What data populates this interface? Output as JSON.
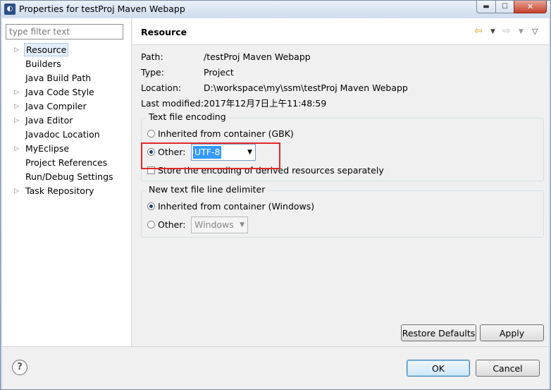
{
  "window": {
    "title": "Properties for testProj Maven Webapp",
    "minimize_glyph": "▬",
    "maximize_glyph": "☐",
    "close_glyph": "✕"
  },
  "filter": {
    "placeholder": "type filter text"
  },
  "tree": [
    {
      "label": "Resource",
      "expandable": true,
      "selected": true
    },
    {
      "label": "Builders",
      "expandable": false
    },
    {
      "label": "Java Build Path",
      "expandable": false
    },
    {
      "label": "Java Code Style",
      "expandable": true
    },
    {
      "label": "Java Compiler",
      "expandable": true
    },
    {
      "label": "Java Editor",
      "expandable": true
    },
    {
      "label": "Javadoc Location",
      "expandable": false
    },
    {
      "label": "MyEclipse",
      "expandable": true
    },
    {
      "label": "Project References",
      "expandable": false
    },
    {
      "label": "Run/Debug Settings",
      "expandable": false
    },
    {
      "label": "Task Repository",
      "expandable": true
    }
  ],
  "header": {
    "title": "Resource",
    "icons": [
      "back-arrow-icon",
      "forward-arrow-icon",
      "view-menu-icon"
    ]
  },
  "properties": {
    "path_label": "Path:",
    "path_value": "/testProj Maven Webapp",
    "type_label": "Type:",
    "type_value": "Project",
    "location_label": "Location:",
    "location_value": "D:\\workspace\\my\\ssm\\testProj Maven Webapp",
    "modified_label": "Last modified:",
    "modified_value": "2017年12月7日上午11:48:59"
  },
  "encoding": {
    "title": "Text file encoding",
    "inherited_label": "Inherited from container (GBK)",
    "other_label": "Other:",
    "other_value": "UTF-8",
    "store_label": "Store the encoding of derived resources separately",
    "selected": "other"
  },
  "delimiter": {
    "title": "New text file line delimiter",
    "inherited_label": "Inherited from container (Windows)",
    "other_label": "Other:",
    "other_value": "Windows",
    "selected": "inherited"
  },
  "buttons": {
    "restore": "Restore Defaults",
    "apply": "Apply",
    "ok": "OK",
    "cancel": "Cancel",
    "help": "?"
  },
  "colors": {
    "highlight": "#e22a2a",
    "selection": "#3399ff"
  }
}
